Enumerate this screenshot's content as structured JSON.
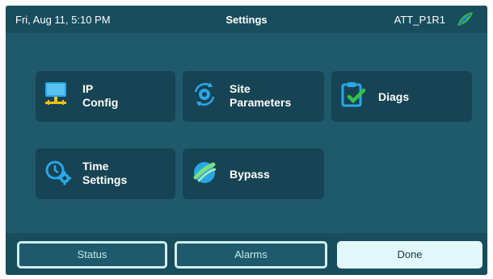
{
  "header": {
    "datetime": "Fri, Aug 11, 5:10 PM",
    "title": "Settings",
    "site_id": "ATT_P1R1",
    "logo_icon": "leaf-logo"
  },
  "tiles": [
    {
      "id": "ip-config",
      "label": "IP\nConfig",
      "icon": "network-monitor-icon"
    },
    {
      "id": "site-parameters",
      "label": "Site\nParameters",
      "icon": "gear-cycle-icon"
    },
    {
      "id": "diags",
      "label": "Diags",
      "icon": "clipboard-check-icon"
    },
    {
      "id": "time-settings",
      "label": "Time\nSettings",
      "icon": "clock-gear-icon"
    },
    {
      "id": "bypass",
      "label": "Bypass",
      "icon": "bypass-globe-icon"
    }
  ],
  "footer": {
    "status_label": "Status",
    "alarms_label": "Alarms",
    "done_label": "Done"
  },
  "colors": {
    "background": "#1e5a6b",
    "bar": "#174d5c",
    "tile": "#164454",
    "accent_blue": "#2aa7e6",
    "accent_yellow": "#f2c400",
    "check_green": "#35c04a"
  }
}
